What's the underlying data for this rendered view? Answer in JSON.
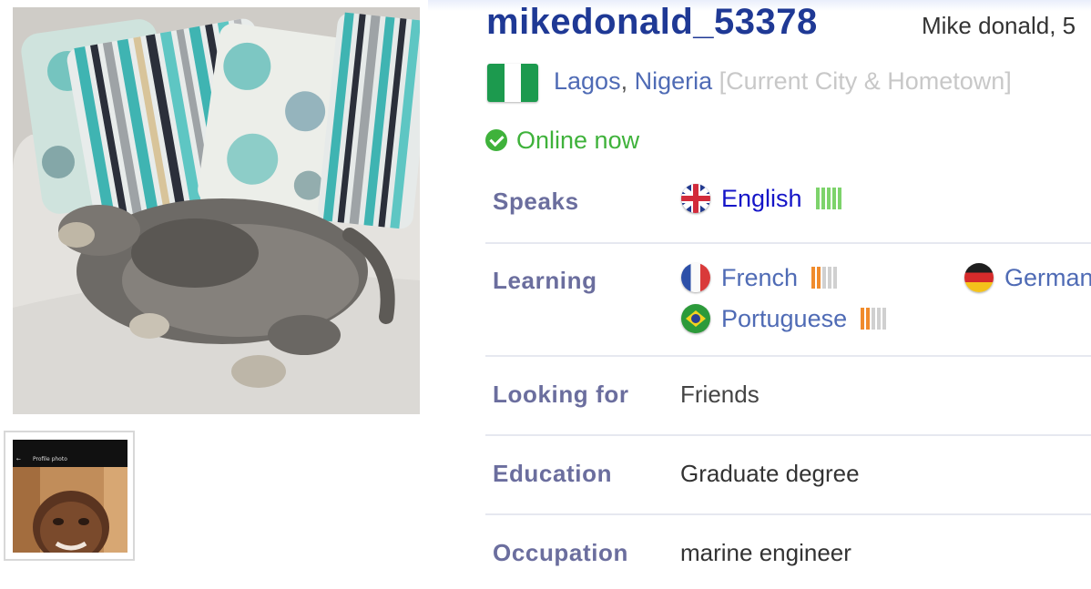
{
  "profile": {
    "username": "mikedonald_53378",
    "real_name": "Mike donald, 5",
    "location": {
      "city": "Lagos",
      "separator": ",",
      "country": "Nigeria",
      "hint": "[Current City & Hometown]",
      "flag_icon": "nigeria-flag-icon",
      "flag_colors": [
        "#1c9a4e",
        "#ffffff",
        "#1c9a4e"
      ]
    },
    "status": "Online now",
    "status_color": "#3fb23b"
  },
  "photos": {
    "thumbnail_bar_title": "Profile photo"
  },
  "details": {
    "speaks": {
      "label": "Speaks",
      "languages": [
        {
          "name": "English",
          "flag_icon": "uk-flag-icon",
          "level": 5,
          "level_color": "#7dd36b"
        }
      ]
    },
    "learning": {
      "label": "Learning",
      "languages": [
        {
          "name": "French",
          "flag_icon": "france-flag-icon",
          "level": 2,
          "level_color": "#f08b2c"
        },
        {
          "name": "German",
          "flag_icon": "germany-flag-icon"
        },
        {
          "name": "Portuguese",
          "flag_icon": "brazil-flag-icon",
          "level": 2,
          "level_color": "#f08b2c"
        }
      ]
    },
    "looking_for": {
      "label": "Looking for",
      "value": "Friends"
    },
    "education": {
      "label": "Education",
      "value": "Graduate degree"
    },
    "occupation": {
      "label": "Occupation",
      "value": "marine engineer"
    }
  }
}
